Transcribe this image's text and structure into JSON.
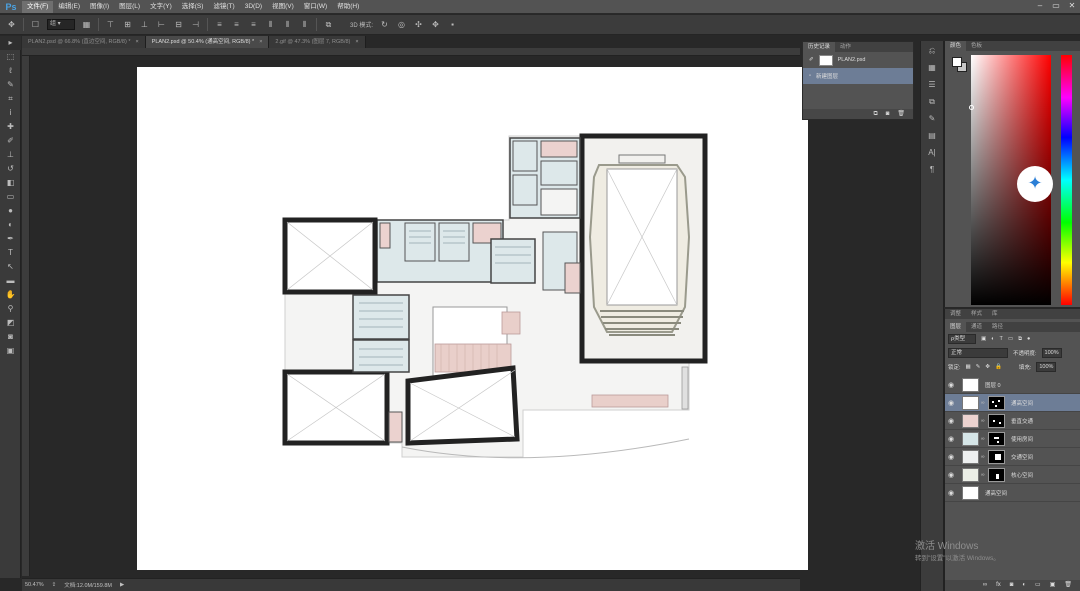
{
  "app": {
    "logo": "Ps"
  },
  "menu": [
    "文件(F)",
    "编辑(E)",
    "图像(I)",
    "图层(L)",
    "文字(Y)",
    "选择(S)",
    "滤镜(T)",
    "3D(D)",
    "视图(V)",
    "窗口(W)",
    "帮助(H)"
  ],
  "window_controls": [
    "–",
    "▭",
    "✕"
  ],
  "options_bar": {
    "mode_value": "3D 模式:"
  },
  "tabs": [
    {
      "label": "PLAN2.psd @ 66.8% (直边空间, RGB/8) *"
    },
    {
      "label": "PLAN2.psd @ 50.4% (通高空间, RGB/8) *",
      "active": true
    },
    {
      "label": "2.gif @ 47.3% (图层 7, RGB/8)"
    }
  ],
  "status": {
    "zoom": "50.47%",
    "doc_size": "文档:12.0M/159.8M"
  },
  "history": {
    "tabs": [
      "历史记录",
      "动作"
    ],
    "rows": [
      {
        "label": "PLAN2.psd"
      },
      {
        "label": "新建图层"
      }
    ]
  },
  "color": {
    "tabs": [
      "颜色",
      "色板"
    ]
  },
  "layers": {
    "top_tabs": [
      "调整",
      "样式",
      "库"
    ],
    "tabs": [
      "图层",
      "通道",
      "路径"
    ],
    "kind_filter": "ρ类型",
    "blend_mode": "正常",
    "opacity_label": "不透明度:",
    "opacity_value": "100%",
    "lock_label": "锁定:",
    "fill_label": "填充:",
    "fill_value": "100%",
    "items": [
      {
        "name": "图层 0",
        "thumb": "#ffffff"
      },
      {
        "name": "通高空间",
        "thumb": "#ffffff",
        "selected": true
      },
      {
        "name": "垂直交通",
        "thumb": "#ebd2cf"
      },
      {
        "name": "使用房间",
        "thumb": "#d6e6e8"
      },
      {
        "name": "交通空间",
        "thumb": "#eef0f0"
      },
      {
        "name": "核心空间",
        "thumb": "#ebeee6"
      },
      {
        "name": "通高空间",
        "thumb": "#ffffff"
      }
    ]
  },
  "watermark": {
    "line1": "激活 Windows",
    "line2": "转到\"设置\"以激活 Windows。"
  }
}
